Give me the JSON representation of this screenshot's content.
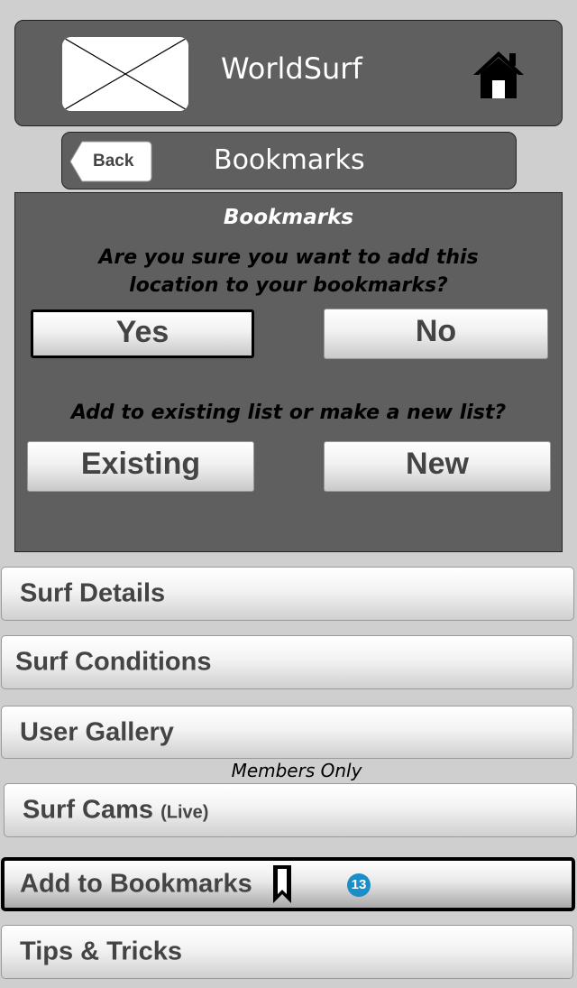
{
  "header": {
    "title": "WorldSurf"
  },
  "nav": {
    "back_label": "Back",
    "title": "Bookmarks"
  },
  "dialog": {
    "title": "Bookmarks",
    "question_line1": "Are you sure you want to add this",
    "question_line2": "location to your bookmarks?",
    "yes_label": "Yes",
    "no_label": "No",
    "list_question": "Add to existing list or make a new list?",
    "existing_label": "Existing",
    "new_label": "New"
  },
  "menu": {
    "surf_details": "Surf Details",
    "surf_conditions": "Surf Conditions",
    "user_gallery": "User Gallery",
    "members_only": "Members Only",
    "surf_cams": "Surf Cams",
    "surf_cams_suffix": "(Live)",
    "add_to_bookmarks": "Add to Bookmarks",
    "tips_tricks": "Tips & Tricks"
  },
  "badge": "13",
  "colors": {
    "panel": "#5f5f5f",
    "background": "#cfcfcf",
    "badge": "#1b8dc8"
  },
  "icons": [
    "image-placeholder-icon",
    "home-icon",
    "back-arrow-icon",
    "bookmark-icon"
  ]
}
